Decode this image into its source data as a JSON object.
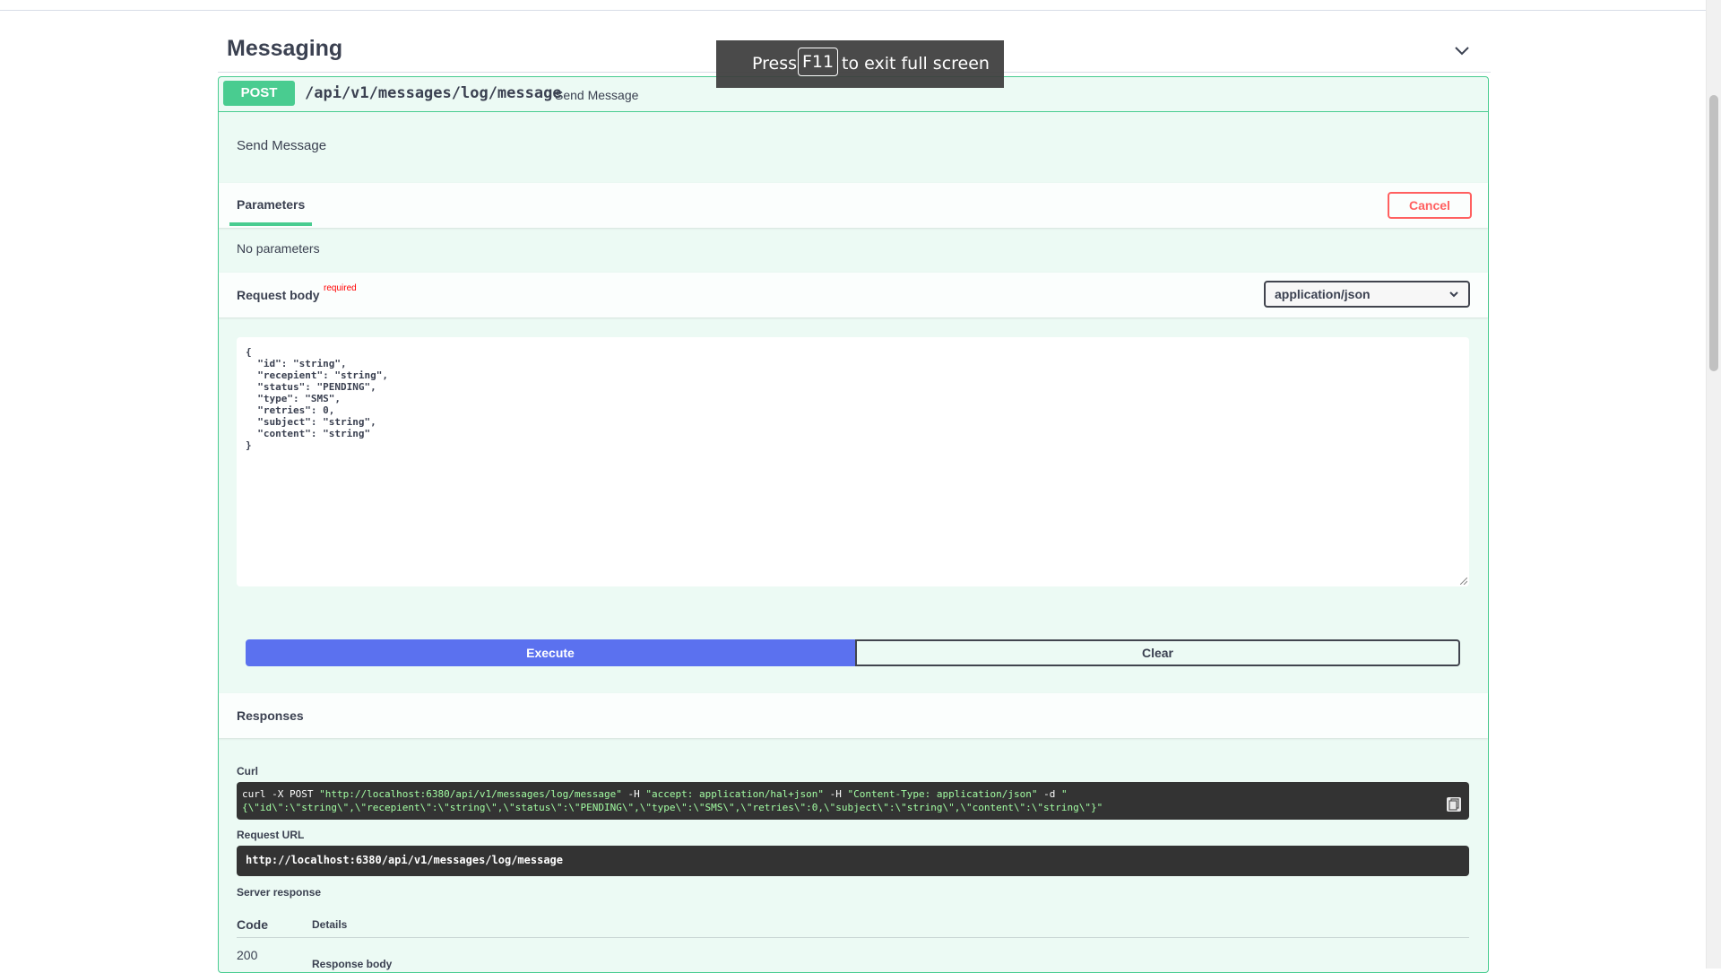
{
  "tag": {
    "title": "Messaging"
  },
  "operation": {
    "method": "POST",
    "path": "/api/v1/messages/log/message",
    "summary": "Send Message",
    "description": "Send Message"
  },
  "parameters": {
    "tab_label": "Parameters",
    "cancel_label": "Cancel",
    "empty_text": "No parameters"
  },
  "request_body": {
    "label": "Request body",
    "required_label": "required",
    "content_type": "application/json",
    "value": "{\n  \"id\": \"string\",\n  \"recepient\": \"string\",\n  \"status\": \"PENDING\",\n  \"type\": \"SMS\",\n  \"retries\": 0,\n  \"subject\": \"string\",\n  \"content\": \"string\"\n}"
  },
  "actions": {
    "execute_label": "Execute",
    "clear_label": "Clear"
  },
  "responses": {
    "label": "Responses",
    "curl_label": "Curl",
    "curl_cmd_part1": "curl -X POST ",
    "curl_url": "\"http://localhost:6380/api/v1/messages/log/message\"",
    "curl_h1_flag": " -H  ",
    "curl_h1": "\"accept: application/hal+json\"",
    "curl_h2_flag": " -H  ",
    "curl_h2": "\"Content-Type: application/json\"",
    "curl_d_flag": " -d ",
    "curl_d_open": "\"",
    "curl_data": "{\\\"id\\\":\\\"string\\\",\\\"recepient\\\":\\\"string\\\",\\\"status\\\":\\\"PENDING\\\",\\\"type\\\":\\\"SMS\\\",\\\"retries\\\":0,\\\"subject\\\":\\\"string\\\",\\\"content\\\":\\\"string\\\"}\"",
    "request_url_label": "Request URL",
    "request_url": "http://localhost:6380/api/v1/messages/log/message",
    "server_response_label": "Server response",
    "col_code": "Code",
    "col_details": "Details",
    "code_value": "200",
    "response_body_label": "Response body"
  },
  "fullscreen_toast": {
    "before": "Press",
    "key": "F11",
    "after": "to exit full screen"
  },
  "colors": {
    "post": "#49cc90",
    "execute": "#5b71ef",
    "cancel": "#ff6060"
  }
}
